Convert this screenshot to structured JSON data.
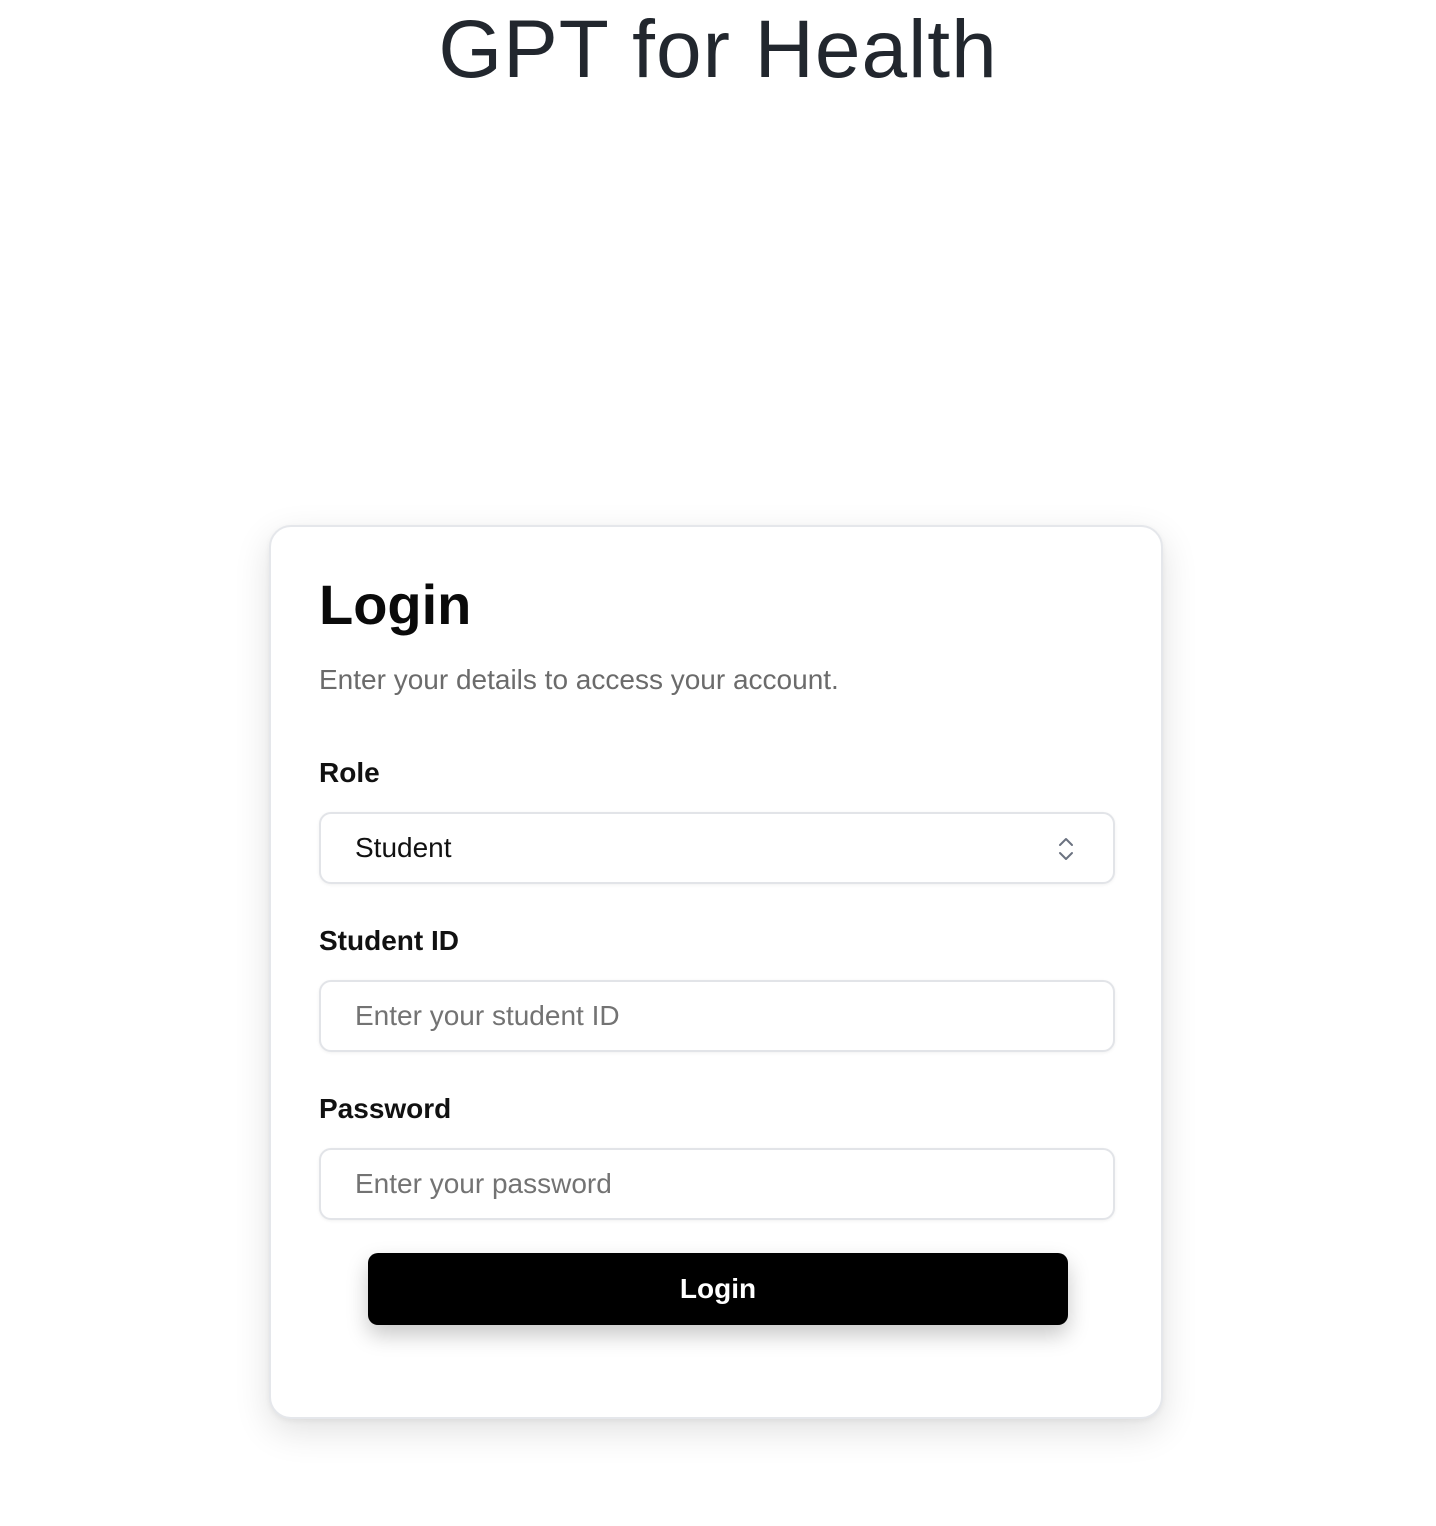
{
  "app": {
    "title": "GPT for Health"
  },
  "login_card": {
    "title": "Login",
    "subtitle": "Enter your details to access your account.",
    "role": {
      "label": "Role",
      "selected": "Student",
      "icon": "chevron-up-down-icon"
    },
    "student_id": {
      "label": "Student ID",
      "value": "",
      "placeholder": "Enter your student ID"
    },
    "password": {
      "label": "Password",
      "value": "",
      "placeholder": "Enter your password"
    },
    "submit_label": "Login"
  },
  "colors": {
    "title_text": "#22272e",
    "button_bg": "#000000",
    "button_text": "#ffffff",
    "border": "#e2e4e8",
    "placeholder": "#737373"
  }
}
